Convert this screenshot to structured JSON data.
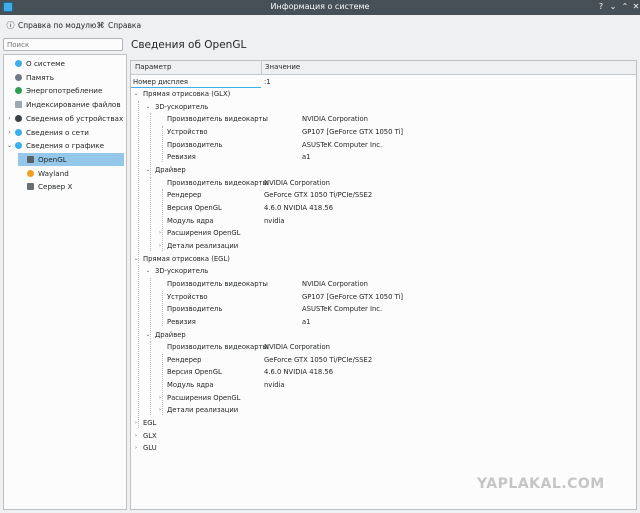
{
  "window": {
    "title": "Информация о системе"
  },
  "toolbar": {
    "help_module": "Справка по модулю",
    "help": "Справка"
  },
  "search": {
    "placeholder": "Поиск"
  },
  "sidebar": {
    "items": [
      {
        "label": "О системе",
        "color": "#3daee9",
        "expander": ""
      },
      {
        "label": "Память",
        "color": "#6f7a84",
        "expander": ""
      },
      {
        "label": "Энергопотребление",
        "color": "#2ca04c",
        "expander": ""
      },
      {
        "label": "Индексирование файлов",
        "color": "#a0a8ae",
        "expander": ""
      },
      {
        "label": "Сведения об устройствах",
        "color": "#3b4045",
        "expander": "›"
      },
      {
        "label": "Сведения о сети",
        "color": "#3daee9",
        "expander": "›"
      },
      {
        "label": "Сведения о графике",
        "color": "#3daee9",
        "expander": "⌄"
      },
      {
        "label": "OpenGL",
        "color": "#586168",
        "expander": ""
      },
      {
        "label": "Wayland",
        "color": "#f0a020",
        "expander": ""
      },
      {
        "label": "Сервер X",
        "color": "#6a6e72",
        "expander": ""
      }
    ]
  },
  "main": {
    "title": "Сведения об OpenGL"
  },
  "table": {
    "col_param": "Параметр",
    "col_value": "Значение",
    "rows": [
      {
        "label": "Номер дисплея",
        "value": ":1",
        "level": 0,
        "exp": ""
      },
      {
        "label": "Прямая отрисовка (GLX)",
        "value": "",
        "level": 0,
        "exp": "⌄"
      },
      {
        "label": "3D-ускоритель",
        "value": "",
        "level": 1,
        "exp": "⌄"
      },
      {
        "label": "Производитель видеокарты",
        "value": "NVIDIA Corporation",
        "level": 2,
        "exp": "",
        "vcol": 2
      },
      {
        "label": "Устройство",
        "value": "GP107 [GeForce GTX 1050 Ti]",
        "level": 2,
        "exp": "",
        "vcol": 2
      },
      {
        "label": "Производитель",
        "value": "ASUSTeK Computer Inc.",
        "level": 2,
        "exp": "",
        "vcol": 2
      },
      {
        "label": "Ревизия",
        "value": "a1",
        "level": 2,
        "exp": "",
        "vcol": 2
      },
      {
        "label": "Драйвер",
        "value": "",
        "level": 1,
        "exp": "⌄"
      },
      {
        "label": "Производитель видеокарты",
        "value": "NVIDIA Corporation",
        "level": 2,
        "exp": "",
        "vcol": 1
      },
      {
        "label": "Рендерер",
        "value": "GeForce GTX 1050 Ti/PCIe/SSE2",
        "level": 2,
        "exp": "",
        "vcol": 1
      },
      {
        "label": "Версия OpenGL",
        "value": "4.6.0 NVIDIA 418.56",
        "level": 2,
        "exp": "",
        "vcol": 1
      },
      {
        "label": "Модуль ядра",
        "value": "nvidia",
        "level": 2,
        "exp": "",
        "vcol": 1
      },
      {
        "label": "Расширения OpenGL",
        "value": "",
        "level": 2,
        "exp": "›"
      },
      {
        "label": "Детали реализации",
        "value": "",
        "level": 2,
        "exp": "›"
      },
      {
        "label": "Прямая отрисовка (EGL)",
        "value": "",
        "level": 0,
        "exp": "⌄"
      },
      {
        "label": "3D-ускоритель",
        "value": "",
        "level": 1,
        "exp": "⌄"
      },
      {
        "label": "Производитель видеокарты",
        "value": "NVIDIA Corporation",
        "level": 2,
        "exp": "",
        "vcol": 2
      },
      {
        "label": "Устройство",
        "value": "GP107 [GeForce GTX 1050 Ti]",
        "level": 2,
        "exp": "",
        "vcol": 2
      },
      {
        "label": "Производитель",
        "value": "ASUSTeK Computer Inc.",
        "level": 2,
        "exp": "",
        "vcol": 2
      },
      {
        "label": "Ревизия",
        "value": "a1",
        "level": 2,
        "exp": "",
        "vcol": 2
      },
      {
        "label": "Драйвер",
        "value": "",
        "level": 1,
        "exp": "⌄"
      },
      {
        "label": "Производитель видеокарты",
        "value": "NVIDIA Corporation",
        "level": 2,
        "exp": "",
        "vcol": 1
      },
      {
        "label": "Рендерер",
        "value": "GeForce GTX 1050 Ti/PCIe/SSE2",
        "level": 2,
        "exp": "",
        "vcol": 1
      },
      {
        "label": "Версия OpenGL",
        "value": "4.6.0 NVIDIA 418.56",
        "level": 2,
        "exp": "",
        "vcol": 1
      },
      {
        "label": "Модуль ядра",
        "value": "nvidia",
        "level": 2,
        "exp": "",
        "vcol": 1
      },
      {
        "label": "Расширения OpenGL",
        "value": "",
        "level": 2,
        "exp": "›"
      },
      {
        "label": "Детали реализации",
        "value": "",
        "level": 2,
        "exp": "›"
      },
      {
        "label": "EGL",
        "value": "",
        "level": 0,
        "exp": "›"
      },
      {
        "label": "GLX",
        "value": "",
        "level": 0,
        "exp": "›"
      },
      {
        "label": "GLU",
        "value": "",
        "level": 0,
        "exp": "›"
      }
    ]
  },
  "watermark": "YAPLAKAL.COM"
}
